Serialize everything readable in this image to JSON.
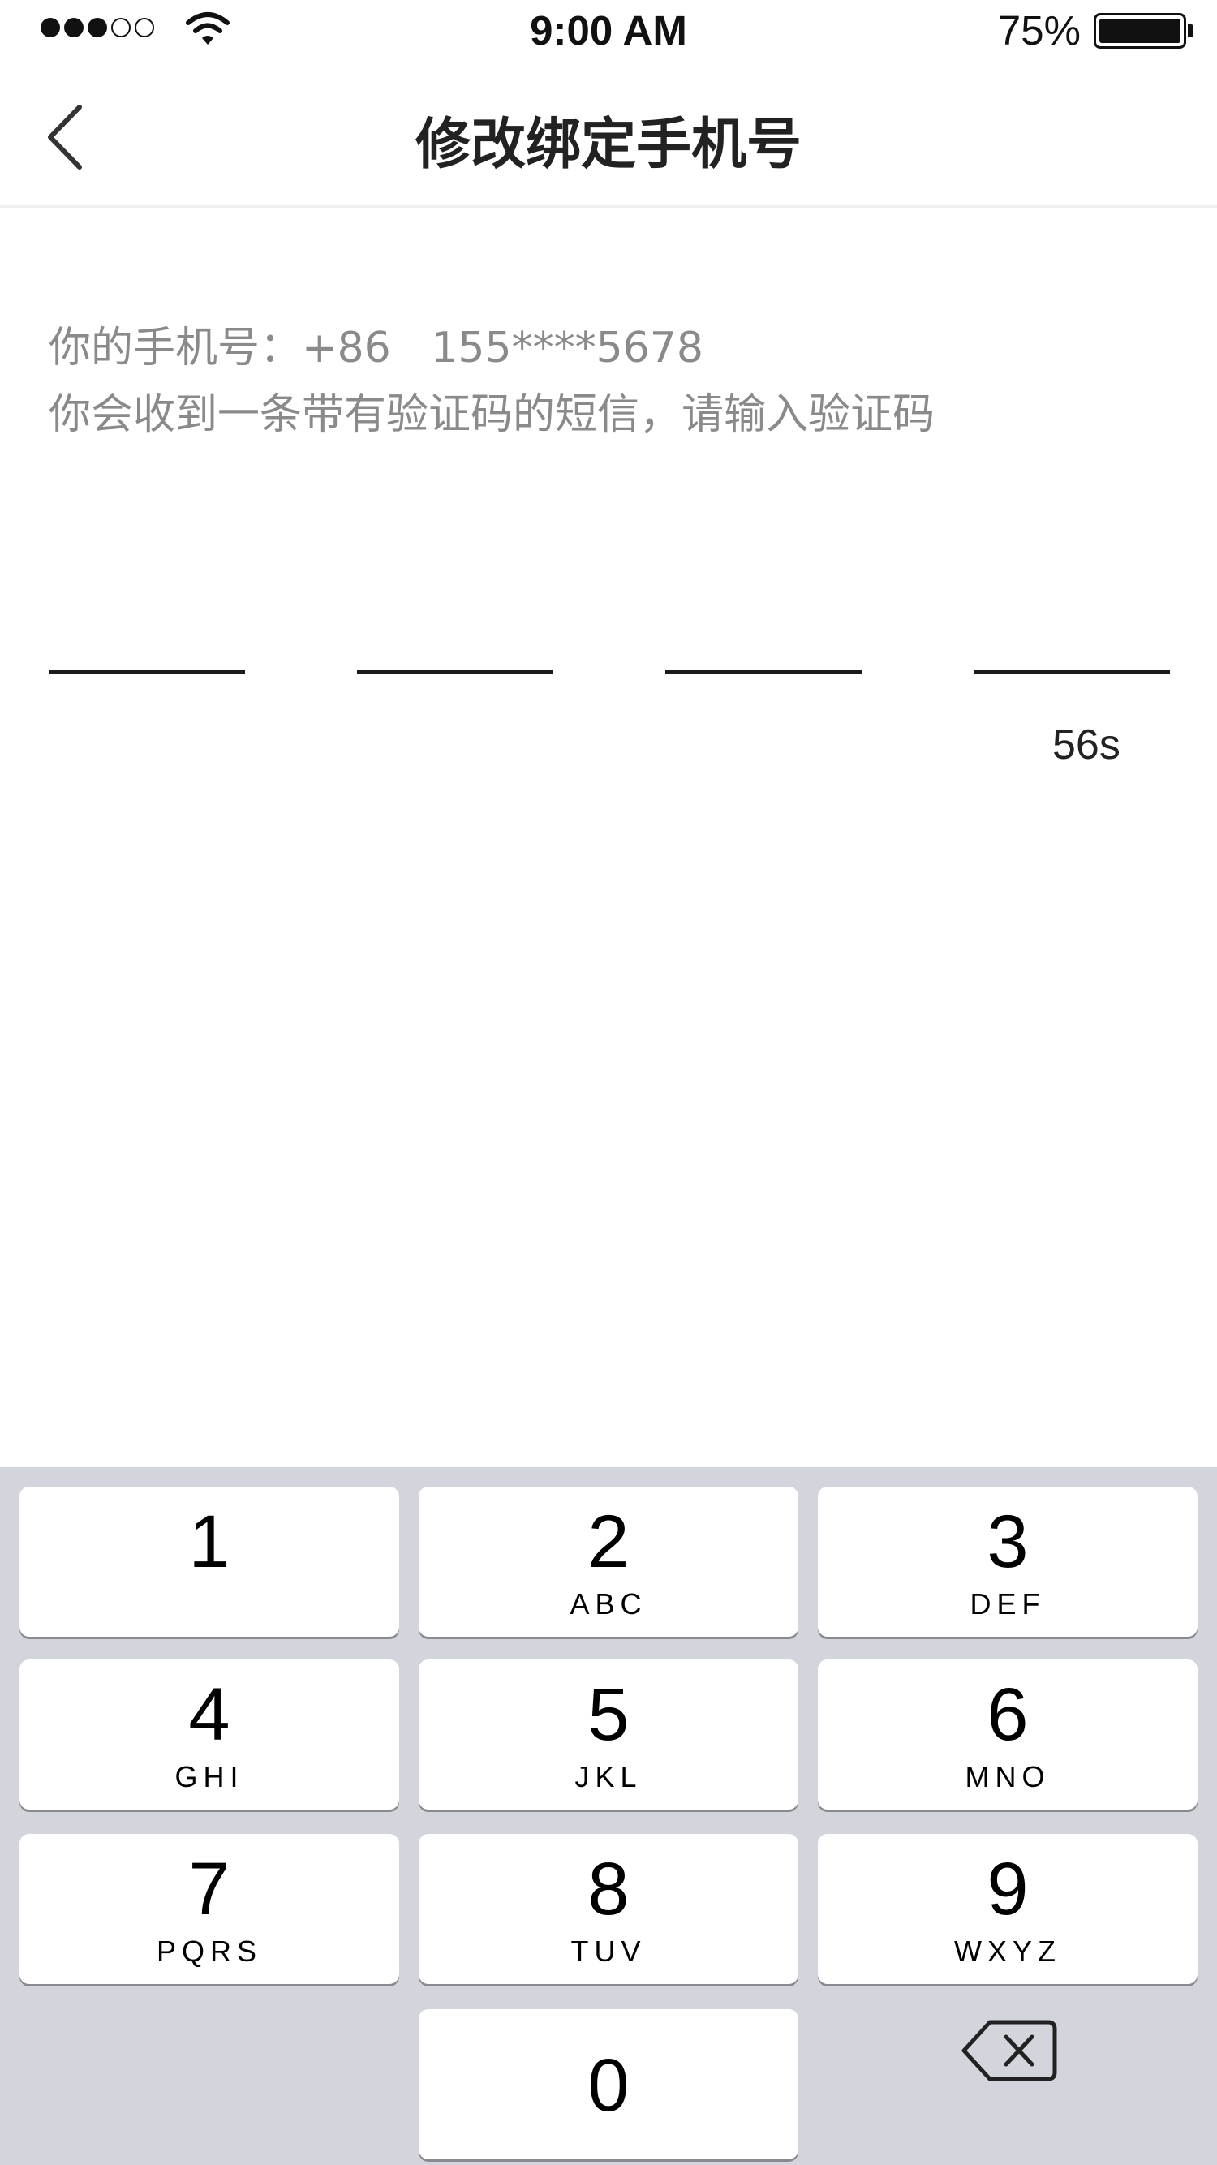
{
  "status_bar": {
    "time": "9:00 AM",
    "battery": "75%",
    "signal_icon": "signal-dots-icon",
    "wifi_icon": "wifi-icon",
    "battery_icon": "battery-icon"
  },
  "nav": {
    "title": "修改绑定手机号",
    "back_icon": "chevron-left-icon"
  },
  "info": {
    "phone_line": "你的手机号：+86   155****5678",
    "hint_line": "你会收到一条带有验证码的短信，请输入验证码"
  },
  "verification": {
    "code_fields": [
      "",
      "",
      "",
      ""
    ],
    "countdown": "56s"
  },
  "keypad": {
    "keys": [
      {
        "digit": "1",
        "letters": ""
      },
      {
        "digit": "2",
        "letters": "ABC"
      },
      {
        "digit": "3",
        "letters": "DEF"
      },
      {
        "digit": "4",
        "letters": "GHI"
      },
      {
        "digit": "5",
        "letters": "JKL"
      },
      {
        "digit": "6",
        "letters": "MNO"
      },
      {
        "digit": "7",
        "letters": "PQRS"
      },
      {
        "digit": "8",
        "letters": "TUV"
      },
      {
        "digit": "9",
        "letters": "WXYZ"
      },
      {
        "digit": "0",
        "letters": ""
      }
    ],
    "delete_icon": "backspace-icon"
  }
}
